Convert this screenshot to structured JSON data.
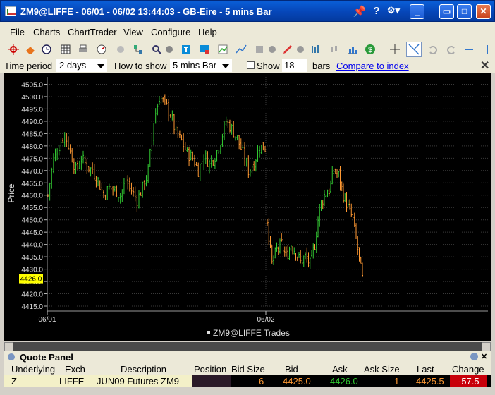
{
  "window": {
    "title": "ZM9@LIFFE - 06/01 - 06/02 13:44:03 - GB-Eire - 5 mins Bar"
  },
  "menu": [
    "File",
    "Charts",
    "ChartTrader",
    "View",
    "Configure",
    "Help"
  ],
  "options": {
    "time_period_label": "Time period",
    "time_period_value": "2 days",
    "how_to_show_label": "How to show",
    "how_to_show_value": "5 mins Bar",
    "show_label": "Show",
    "bars_value": "18",
    "bars_label": "bars",
    "compare_link": "Compare to index"
  },
  "chart": {
    "ylabel": "Price",
    "legend": "ZM9@LIFFE Trades",
    "last_price_tag": "4426.0",
    "colors": {
      "up": "#33cc33",
      "down": "#ff9933",
      "grid": "#3a3a3a",
      "tag": "#ffff00"
    }
  },
  "chart_data": {
    "type": "bar",
    "ylabel": "Price",
    "ylim": [
      4413,
      4508
    ],
    "yticks": [
      4415.0,
      4420.0,
      4425.0,
      4430.0,
      4435.0,
      4440.0,
      4445.0,
      4450.0,
      4455.0,
      4460.0,
      4465.0,
      4470.0,
      4475.0,
      4480.0,
      4485.0,
      4490.0,
      4495.0,
      4500.0,
      4505.0
    ],
    "xticks": [
      "06/01",
      "06/02"
    ],
    "series": [
      {
        "name": "ZM9@LIFFE Trades",
        "day1_close_path": [
          4460,
          4475,
          4480,
          4485,
          4478,
          4470,
          4475,
          4472,
          4470,
          4466,
          4460,
          4463,
          4462,
          4460,
          4466,
          4462,
          4458,
          4463,
          4470,
          4490,
          4500,
          4497,
          4493,
          4485,
          4482,
          4477,
          4475,
          4470,
          4476,
          4473,
          4476,
          4482,
          4490,
          4487,
          4483,
          4477,
          4470,
          4473,
          4480,
          4479
        ],
        "day2_close_path": [
          4450,
          4432,
          4438,
          4440,
          4435,
          4440,
          4437,
          4433,
          4435,
          4432,
          4440,
          4455,
          4460,
          4462,
          4470,
          4468,
          4460,
          4455,
          4450,
          4438,
          4426
        ]
      }
    ]
  },
  "quote_panel": {
    "title": "Quote Panel",
    "columns": [
      "Underlying",
      "Exch",
      "Description",
      "Position",
      "Bid Size",
      "Bid",
      "Ask",
      "Ask Size",
      "Last",
      "Change"
    ],
    "row": {
      "underlying": "Z",
      "exch": "LIFFE",
      "description": "JUN09 Futures ZM9",
      "position": "",
      "bid_size": "6",
      "bid": "4425.0",
      "ask": "4426.0",
      "ask_size": "1",
      "last": "4425.5",
      "change": "-57.5"
    }
  }
}
